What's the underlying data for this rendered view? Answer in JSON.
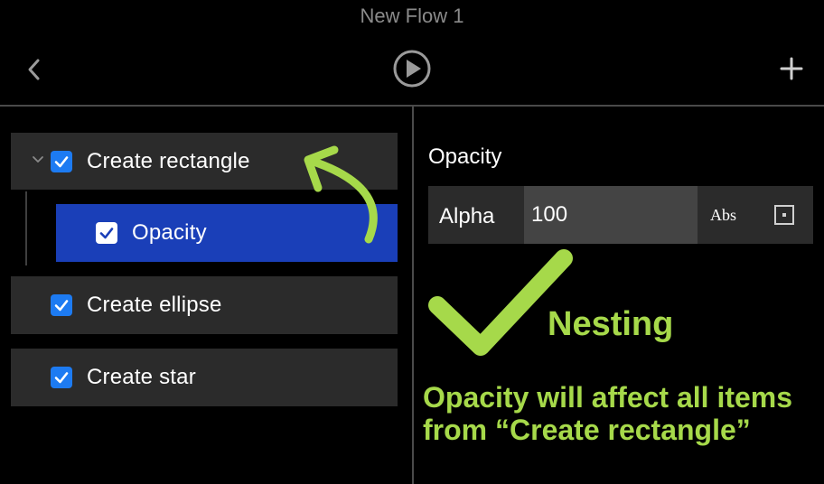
{
  "window": {
    "title": "New Flow 1"
  },
  "toolbar": {
    "back_icon": "chevron-left-icon",
    "play_icon": "play-circle-icon",
    "add_icon": "plus-icon"
  },
  "actions": [
    {
      "label": "Create rectangle",
      "checked": true,
      "expanded": true
    },
    {
      "label": "Opacity",
      "checked": true,
      "selected": true,
      "nested": true
    },
    {
      "label": "Create ellipse",
      "checked": true
    },
    {
      "label": "Create star",
      "checked": true
    }
  ],
  "inspector": {
    "section_title": "Opacity",
    "property_label": "Alpha",
    "property_value": "100",
    "mode_label": "Abs"
  },
  "annotation": {
    "heading": "Nesting",
    "line1": "Opacity will affect all items",
    "line2": "from “Create rectangle”"
  },
  "colors": {
    "accent": "#1d7bf2",
    "selected_row": "#1a3fb8",
    "annotation": "#a6d94a"
  }
}
